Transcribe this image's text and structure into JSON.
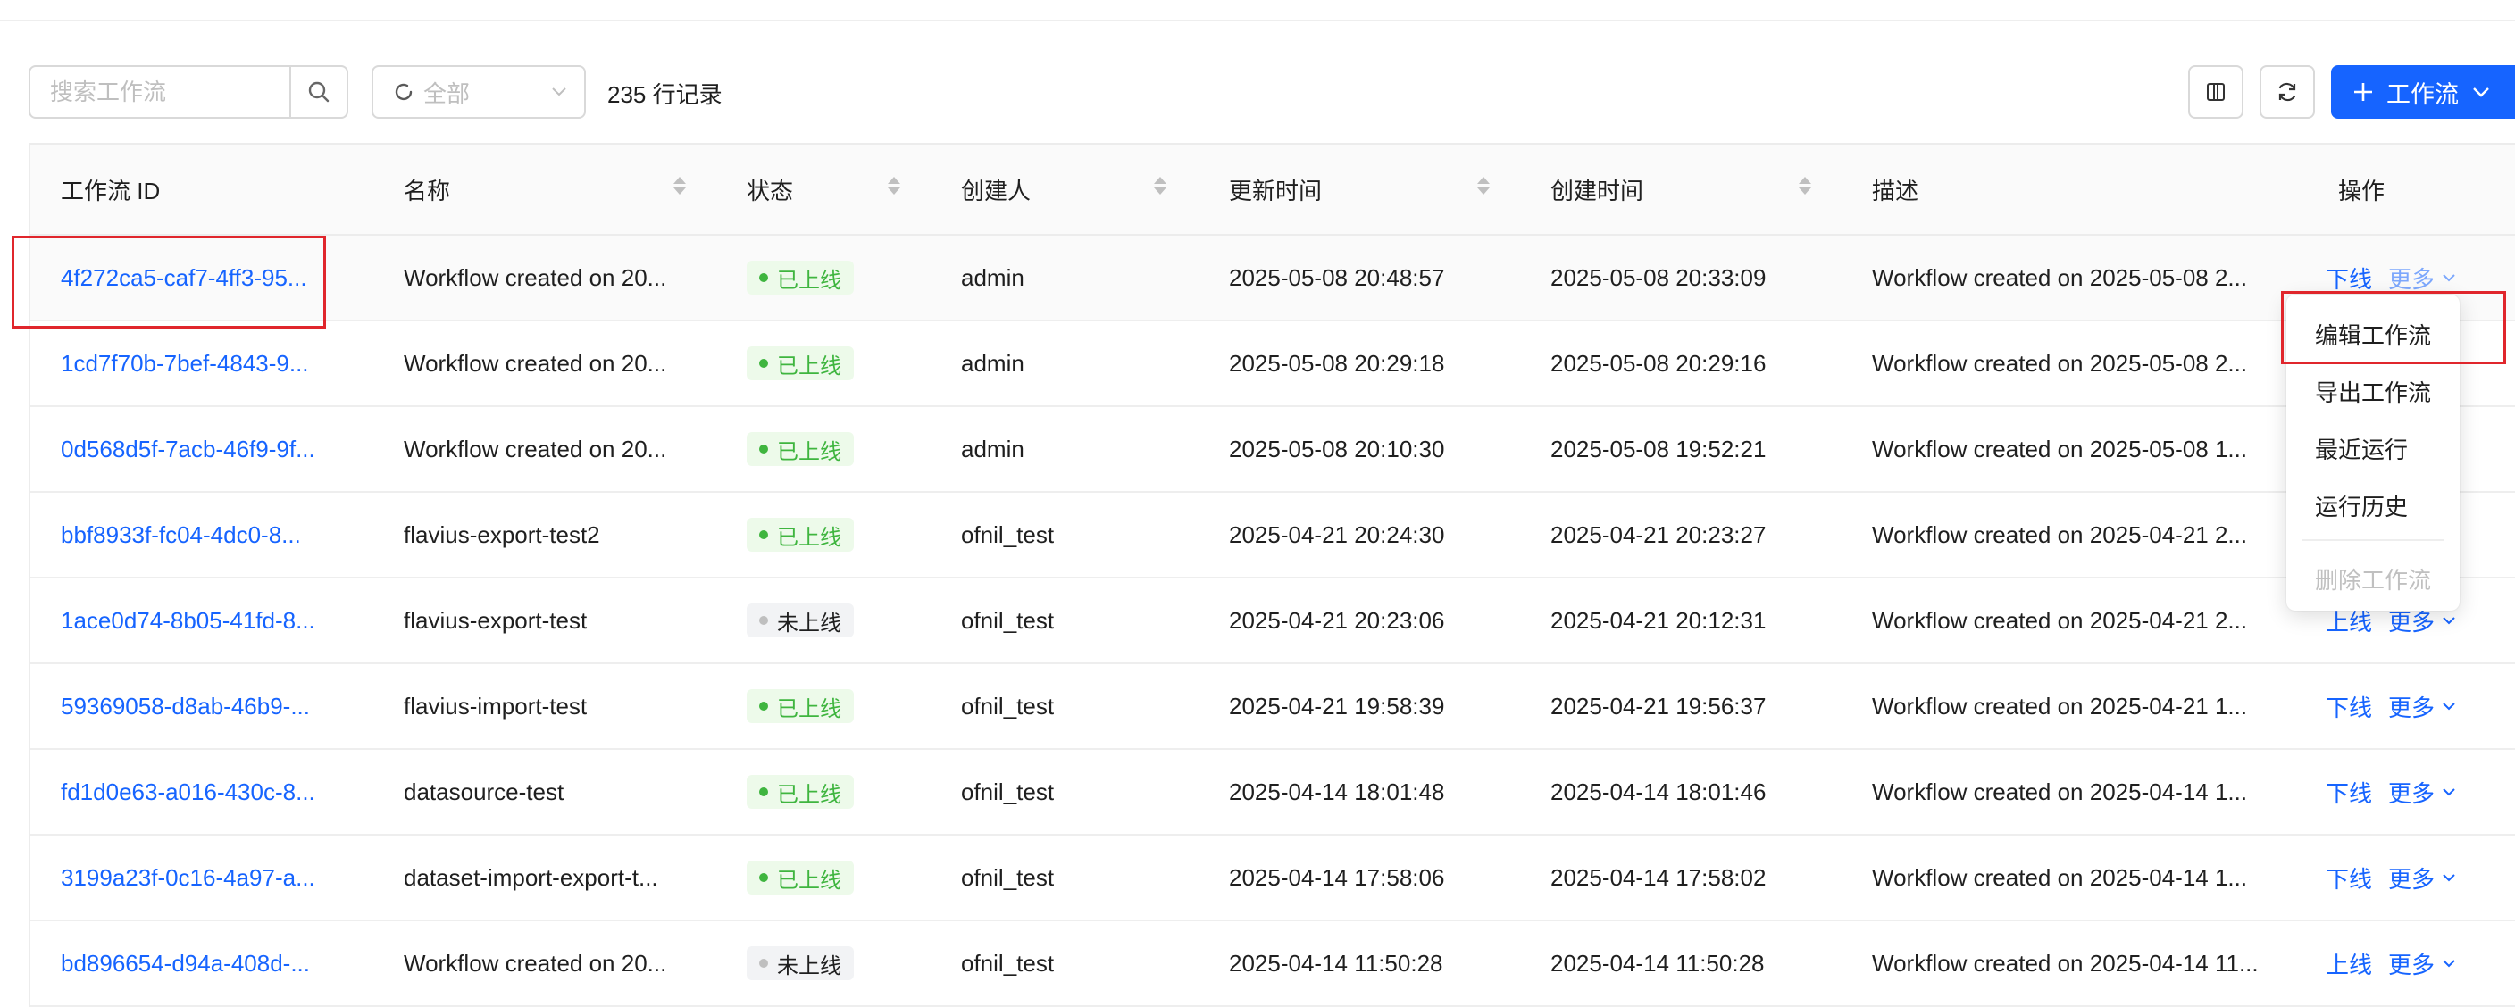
{
  "toolbar": {
    "search_placeholder": "搜索工作流",
    "status_filter": "全部",
    "record_count": "235 行记录",
    "primary_button": "工作流"
  },
  "table": {
    "columns": [
      "工作流 ID",
      "名称",
      "状态",
      "创建人",
      "更新时间",
      "创建时间",
      "描述",
      "操作"
    ],
    "rows": [
      {
        "id": "4f272ca5-caf7-4ff3-95...",
        "name": "Workflow created on 20...",
        "status": "已上线",
        "creator": "admin",
        "updated": "2025-05-08 20:48:57",
        "created": "2025-05-08 20:33:09",
        "desc": "Workflow created on 2025-05-08 2...",
        "action": "下线",
        "more": "更多"
      },
      {
        "id": "1cd7f70b-7bef-4843-9...",
        "name": "Workflow created on 20...",
        "status": "已上线",
        "creator": "admin",
        "updated": "2025-05-08 20:29:18",
        "created": "2025-05-08 20:29:16",
        "desc": "Workflow created on 2025-05-08 2...",
        "action": "",
        "more": ""
      },
      {
        "id": "0d568d5f-7acb-46f9-9f...",
        "name": "Workflow created on 20...",
        "status": "已上线",
        "creator": "admin",
        "updated": "2025-05-08 20:10:30",
        "created": "2025-05-08 19:52:21",
        "desc": "Workflow created on 2025-05-08 1...",
        "action": "",
        "more": ""
      },
      {
        "id": "bbf8933f-fc04-4dc0-8...",
        "name": "flavius-export-test2",
        "status": "已上线",
        "creator": "ofnil_test",
        "updated": "2025-04-21 20:24:30",
        "created": "2025-04-21 20:23:27",
        "desc": "Workflow created on 2025-04-21 2...",
        "action": "",
        "more": ""
      },
      {
        "id": "1ace0d74-8b05-41fd-8...",
        "name": "flavius-export-test",
        "status": "未上线",
        "creator": "ofnil_test",
        "updated": "2025-04-21 20:23:06",
        "created": "2025-04-21 20:12:31",
        "desc": "Workflow created on 2025-04-21 2...",
        "action": "上线",
        "more": "更多"
      },
      {
        "id": "59369058-d8ab-46b9-...",
        "name": "flavius-import-test",
        "status": "已上线",
        "creator": "ofnil_test",
        "updated": "2025-04-21 19:58:39",
        "created": "2025-04-21 19:56:37",
        "desc": "Workflow created on 2025-04-21 1...",
        "action": "下线",
        "more": "更多"
      },
      {
        "id": "fd1d0e63-a016-430c-8...",
        "name": "datasource-test",
        "status": "已上线",
        "creator": "ofnil_test",
        "updated": "2025-04-14 18:01:48",
        "created": "2025-04-14 18:01:46",
        "desc": "Workflow created on 2025-04-14 1...",
        "action": "下线",
        "more": "更多"
      },
      {
        "id": "3199a23f-0c16-4a97-a...",
        "name": "dataset-import-export-t...",
        "status": "已上线",
        "creator": "ofnil_test",
        "updated": "2025-04-14 17:58:06",
        "created": "2025-04-14 17:58:02",
        "desc": "Workflow created on 2025-04-14 1...",
        "action": "下线",
        "more": "更多"
      },
      {
        "id": "bd896654-d94a-408d-...",
        "name": "Workflow created on 20...",
        "status": "未上线",
        "creator": "ofnil_test",
        "updated": "2025-04-14 11:50:28",
        "created": "2025-04-14 11:50:28",
        "desc": "Workflow created on 2025-04-14 11...",
        "action": "上线",
        "more": "更多"
      }
    ]
  },
  "dropdown": {
    "items": [
      "编辑工作流",
      "导出工作流",
      "最近运行",
      "运行历史",
      "删除工作流"
    ]
  },
  "colors": {
    "primary": "#1664ff",
    "online_tag_bg": "#edfaea",
    "online_tag_text": "#3fb53f",
    "annotation": "#e0262c"
  }
}
